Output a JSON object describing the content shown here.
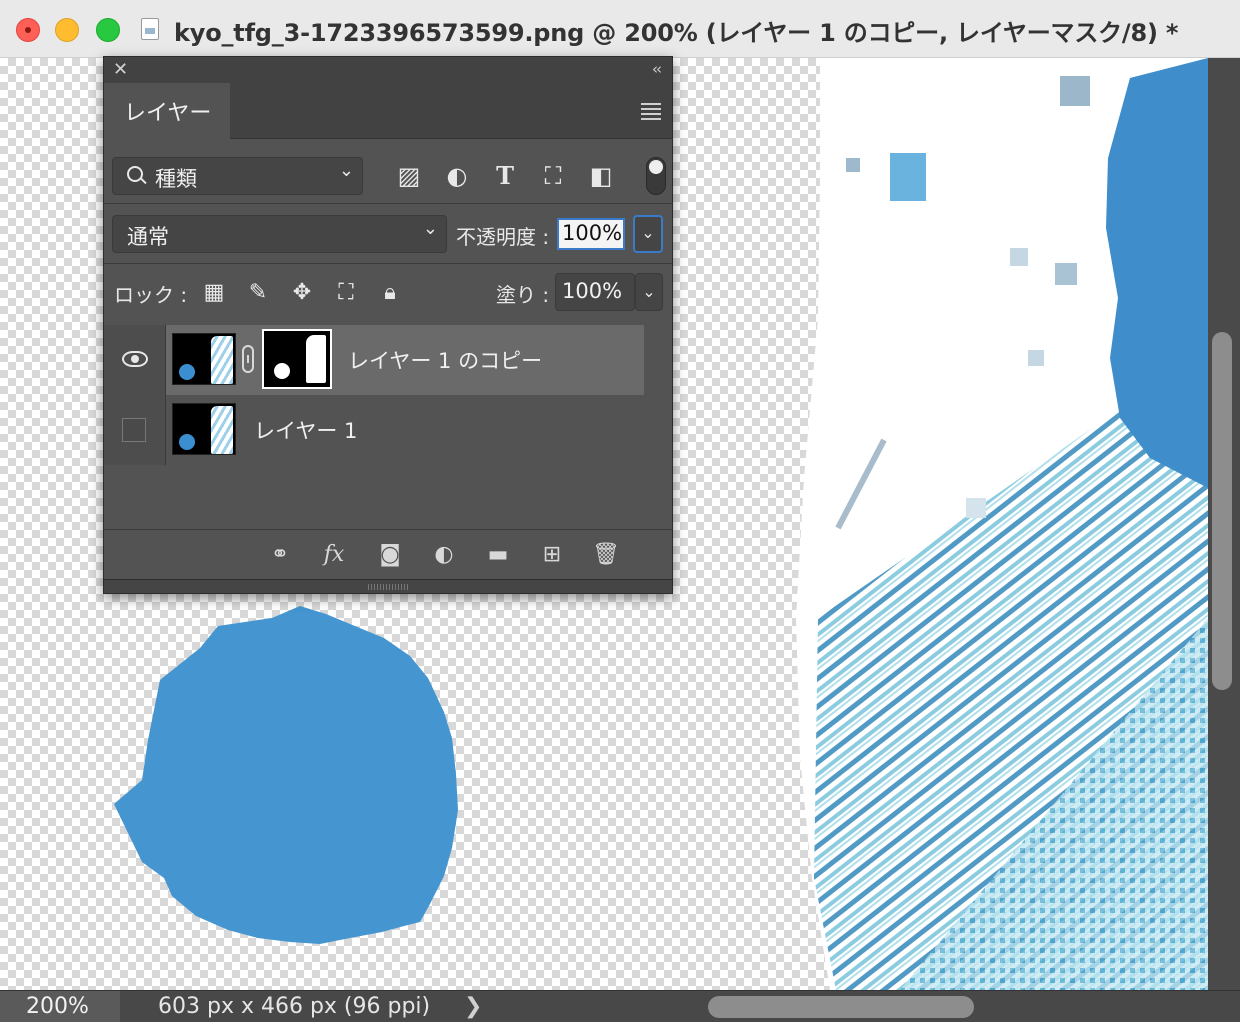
{
  "window": {
    "title": "kyo_tfg_3-1723396573599.png @ 200% (レイヤー 1 のコピー, レイヤーマスク/8) *"
  },
  "layers_panel": {
    "tab_label": "レイヤー",
    "filter": {
      "selected": "種類"
    },
    "blend_mode": {
      "selected": "通常"
    },
    "opacity": {
      "label": "不透明度 :",
      "value": "100%"
    },
    "lock": {
      "label": "ロック :"
    },
    "fill": {
      "label": "塗り :",
      "value": "100%"
    },
    "layers": [
      {
        "name": "レイヤー 1 のコピー",
        "visible": true,
        "selected": true,
        "has_mask": true
      },
      {
        "name": "レイヤー 1",
        "visible": false,
        "selected": false,
        "has_mask": false
      }
    ]
  },
  "status_bar": {
    "zoom": "200%",
    "doc_info": "603 px x 466 px (96 ppi)"
  },
  "colors": {
    "accent": "#3a7ac8",
    "splash_blue": "#4495d0",
    "panel_bg": "#535353"
  }
}
